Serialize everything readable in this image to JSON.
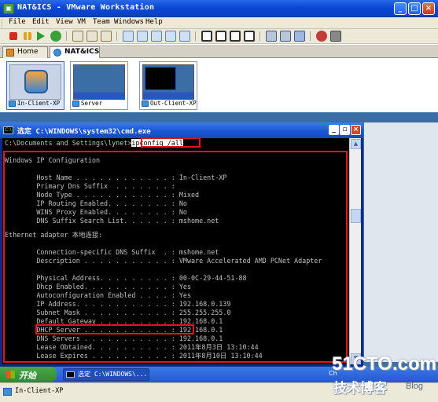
{
  "window": {
    "title": "NAT&ICS - VMware Workstation",
    "controls": {
      "minimize": "_",
      "maximize": "□",
      "close": "×"
    }
  },
  "menu": [
    "File",
    "Edit",
    "View",
    "VM",
    "Team",
    "Windows",
    "Help"
  ],
  "tabs": [
    {
      "label": "Home",
      "icon": "home-icon"
    },
    {
      "label": "NAT&ICS",
      "icon": "team-icon",
      "active": true
    }
  ],
  "vms": [
    {
      "label": "In-Client-XP",
      "selected": true
    },
    {
      "label": "Server",
      "selected": false
    },
    {
      "label": "Out-Client-XP",
      "selected": false
    }
  ],
  "cmd": {
    "title": "选定 C:\\WINDOWS\\system32\\cmd.exe",
    "prompt": "C:\\Documents and Settings\\lynet>",
    "command": "ipconfig /all",
    "lines": [
      "Windows IP Configuration",
      "",
      "        Host Name . . . . . . . . . . . . : In-Client-XP",
      "        Primary Dns Suffix  . . . . . . . :",
      "        Node Type . . . . . . . . . . . . : Mixed",
      "        IP Routing Enabled. . . . . . . . : No",
      "        WINS Proxy Enabled. . . . . . . . : No",
      "        DNS Suffix Search List. . . . . . : mshome.net",
      "",
      "Ethernet adapter 本地连接:",
      "",
      "        Connection-specific DNS Suffix  . : mshome.net",
      "        Description . . . . . . . . . . . : VMware Accelerated AMD PCNet Adapter",
      "",
      "        Physical Address. . . . . . . . . : 00-0C-29-44-51-88",
      "        Dhcp Enabled. . . . . . . . . . . : Yes",
      "        Autoconfiguration Enabled . . . . : Yes",
      "        IP Address. . . . . . . . . . . . : 192.168.0.139",
      "        Subnet Mask . . . . . . . . . . . : 255.255.255.0",
      "        Default Gateway . . . . . . . . . : 192.168.0.1",
      "        DHCP Server . . . . . . . . . . . : 192.168.0.1",
      "        DNS Servers . . . . . . . . . . . : 192.168.0.1",
      "        Lease Obtained. . . . . . . . . . : 2011年8月3日 13:10:44",
      "        Lease Expires . . . . . . . . . . : 2011年8月10日 13:10:44"
    ]
  },
  "taskbar": {
    "start": "开始",
    "task": "选定 C:\\WINDOWS\\...",
    "tray": "Ch"
  },
  "status": {
    "text": "In-Client-XP"
  },
  "watermark": {
    "site": "51CTO.com",
    "cn": "技术博客",
    "blog": "Blog"
  }
}
